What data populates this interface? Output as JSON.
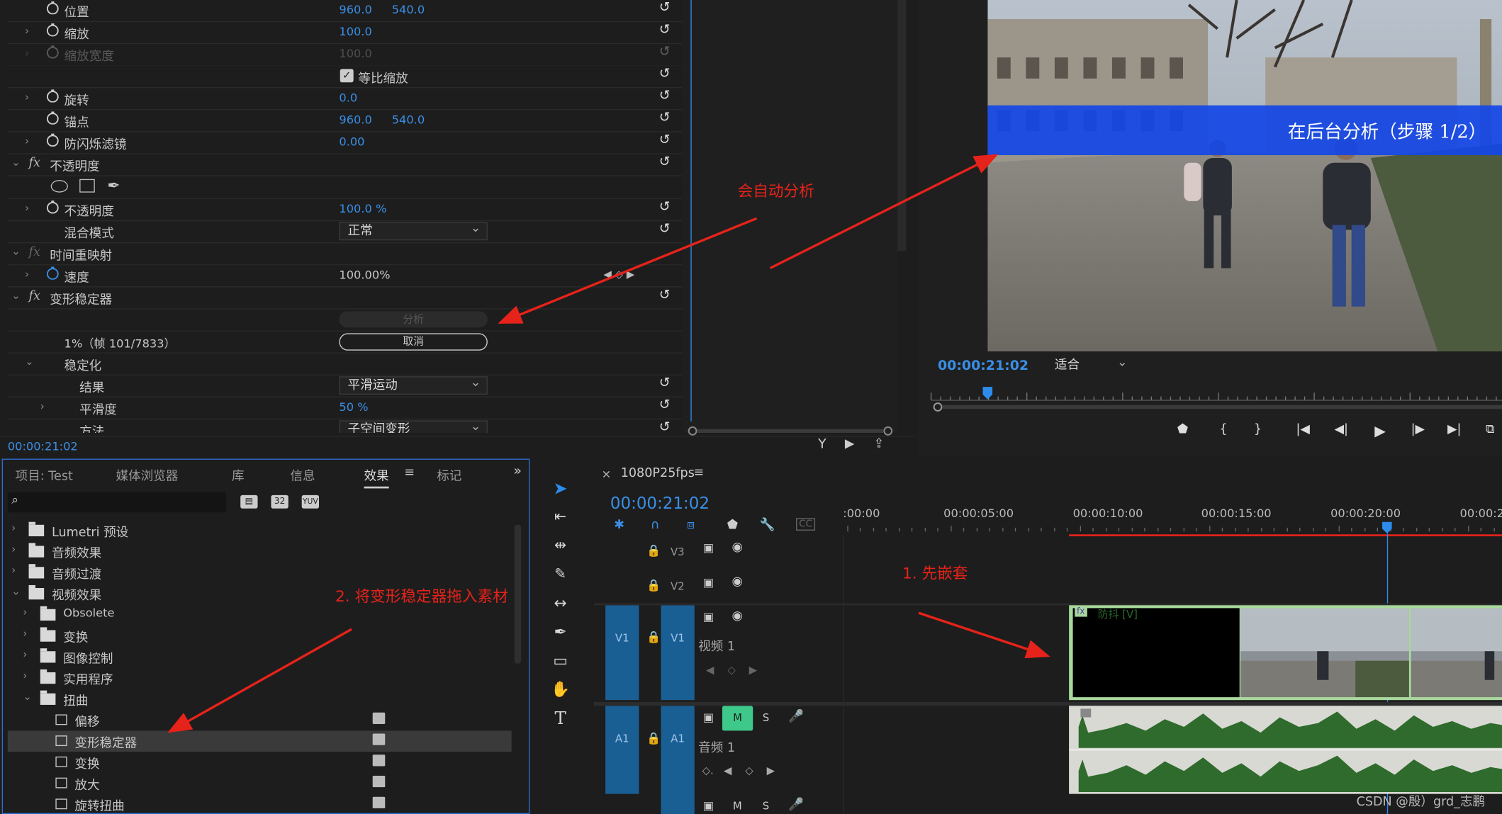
{
  "effect_controls": {
    "props": [
      {
        "label": "位置",
        "v1": "960.0",
        "v2": "540.0"
      },
      {
        "label": "缩放",
        "v1": "100.0"
      },
      {
        "label": "缩放宽度",
        "v1": "100.0"
      },
      {
        "label": "等比缩放"
      },
      {
        "label": "旋转",
        "v1": "0.0"
      },
      {
        "label": "锚点",
        "v1": "960.0",
        "v2": "540.0"
      },
      {
        "label": "防闪烁滤镜",
        "v1": "0.00"
      }
    ],
    "opacity_section": "不透明度",
    "opacity_label": "不透明度",
    "opacity_value": "100.0 %",
    "blend_label": "混合模式",
    "blend_value": "正常",
    "time_remap": "时间重映射",
    "speed_label": "速度",
    "speed_value": "100.00%",
    "warp_section": "变形稳定器",
    "analyze_button": "分析",
    "progress_text": "1%（帧 101/7833）",
    "cancel_button": "取消",
    "stabilize": "稳定化",
    "result_label": "结果",
    "result_value": "平滑运动",
    "smooth_label": "平滑度",
    "smooth_value": "50 %",
    "method_label": "方法",
    "method_value": "子空间变形",
    "timecode": "00:00:21:02",
    "fx": "fx"
  },
  "annotations": {
    "auto_analyze": "会自动分析",
    "drag_effect": "2. 将变形稳定器拖入素材",
    "nest_first": "1. 先嵌套"
  },
  "program_monitor": {
    "overlay_text": "在后台分析（步骤 1/2）",
    "timecode": "00:00:21:02",
    "fit": "适合"
  },
  "project_panel": {
    "tabs": [
      "项目: Test",
      "媒体浏览器",
      "库",
      "信息",
      "效果",
      "标记"
    ],
    "active_tab": "效果",
    "tree": [
      {
        "label": "Lumetri 预设",
        "kind": "folder"
      },
      {
        "label": "音频效果",
        "kind": "folder"
      },
      {
        "label": "音频过渡",
        "kind": "folder"
      },
      {
        "label": "视频效果",
        "kind": "folder"
      },
      {
        "label": "Obsolete",
        "kind": "folder"
      },
      {
        "label": "变换",
        "kind": "folder"
      },
      {
        "label": "图像控制",
        "kind": "folder"
      },
      {
        "label": "实用程序",
        "kind": "folder"
      },
      {
        "label": "扭曲",
        "kind": "folder"
      },
      {
        "label": "偏移",
        "kind": "effect"
      },
      {
        "label": "变形稳定器",
        "kind": "effect"
      },
      {
        "label": "变换",
        "kind": "effect"
      },
      {
        "label": "放大",
        "kind": "effect"
      },
      {
        "label": "旋转扭曲",
        "kind": "effect"
      }
    ],
    "badges": [
      "32",
      "YUV"
    ]
  },
  "timeline": {
    "sequence": "1080P25fps",
    "timecode": "00:00:21:02",
    "ruler": [
      ":00:00",
      "00:00:05:00",
      "00:00:10:00",
      "00:00:15:00",
      "00:00:20:00",
      "00:00:2"
    ],
    "tracks": {
      "v3": "V3",
      "v2": "V2",
      "v1": "V1",
      "a1": "A1",
      "video1": "视频 1",
      "audio1": "音频 1",
      "m": "M",
      "s": "S"
    },
    "clip_label": "防抖 [V]",
    "clip_fx": "fx"
  },
  "watermark": "CSDN @殷）grd_志鹏",
  "colors": {
    "accent": "#2d8ceb",
    "annotation": "#e6231a",
    "audio": "#2f6b2c",
    "clip_green": "#a8d89c",
    "track_blue": "#1a5f94"
  }
}
